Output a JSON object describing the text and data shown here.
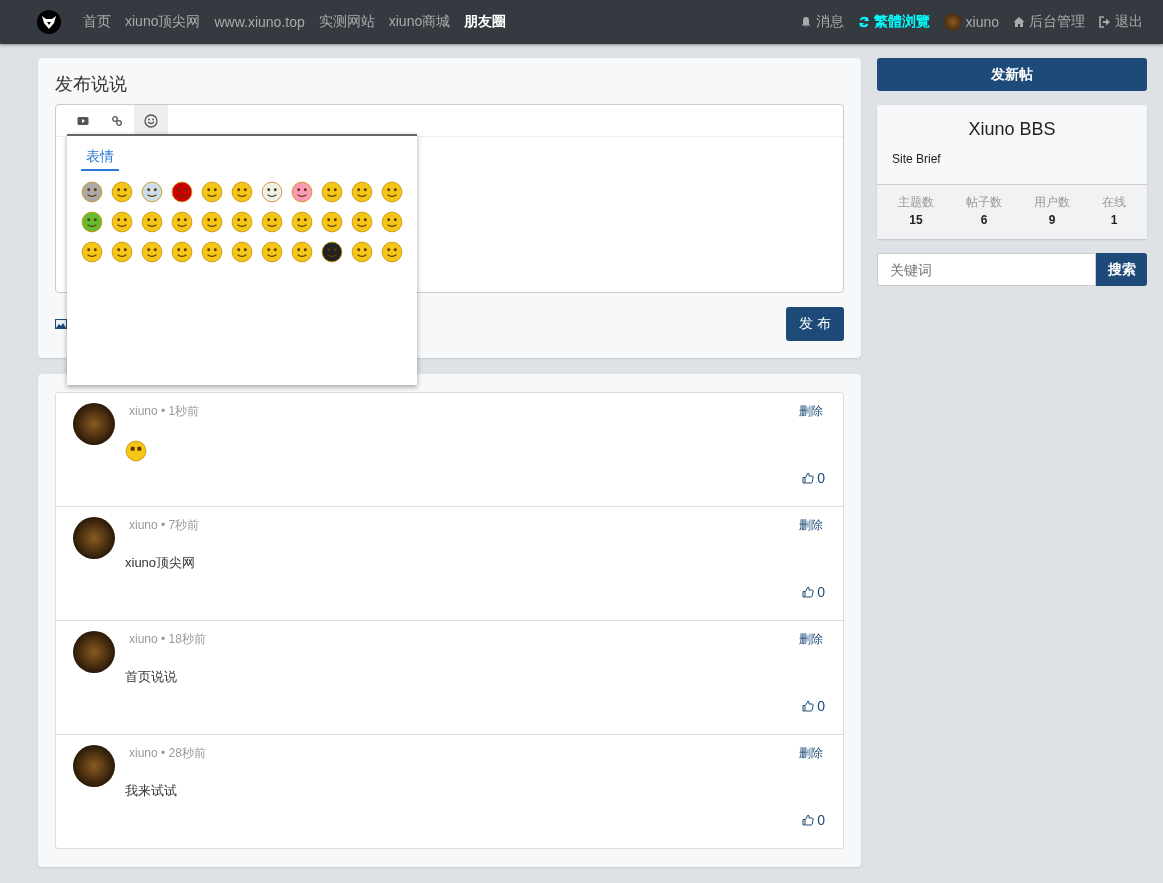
{
  "nav": {
    "items": [
      {
        "label": "首页",
        "selected": false
      },
      {
        "label": "xiuno顶尖网",
        "selected": false
      },
      {
        "label": "www.xiuno.top",
        "selected": false
      },
      {
        "label": "实测网站",
        "selected": false
      },
      {
        "label": "xiuno商城",
        "selected": false
      },
      {
        "label": "朋友圈",
        "selected": true
      }
    ],
    "right": [
      {
        "kind": "bell",
        "label": "消息"
      },
      {
        "kind": "refresh",
        "label": "繁體浏覽"
      },
      {
        "kind": "avatar",
        "label": "xiuno"
      },
      {
        "kind": "home",
        "label": "后台管理"
      },
      {
        "kind": "logout",
        "label": "退出"
      }
    ]
  },
  "composer": {
    "title": "发布说说",
    "tools": [
      {
        "kind": "video",
        "selected": false
      },
      {
        "kind": "link",
        "selected": false
      },
      {
        "kind": "smile",
        "selected": true
      }
    ],
    "emoji_panel": {
      "tab": "表情"
    },
    "submit": "发 布"
  },
  "posts": [
    {
      "meta": "xiuno • 1秒前",
      "kind": "emoji",
      "delete": "删除",
      "likes": "0"
    },
    {
      "meta": "xiuno • 7秒前",
      "kind": "text",
      "content": "xiuno顶尖网",
      "delete": "删除",
      "likes": "0"
    },
    {
      "meta": "xiuno • 18秒前",
      "kind": "text",
      "content": "首页说说",
      "delete": "删除",
      "likes": "0"
    },
    {
      "meta": "xiuno • 28秒前",
      "kind": "text",
      "content": "我来试试",
      "delete": "删除",
      "likes": "0"
    }
  ],
  "sidebar": {
    "new_post": "发新帖",
    "site": {
      "name": "Xiuno BBS",
      "brief": "Site Brief",
      "stats": [
        {
          "label": "主题数",
          "value": "15"
        },
        {
          "label": "帖子数",
          "value": "6"
        },
        {
          "label": "用户数",
          "value": "9"
        },
        {
          "label": "在线",
          "value": "1"
        }
      ]
    },
    "search": {
      "placeholder": "关键词",
      "button": "搜索"
    }
  }
}
